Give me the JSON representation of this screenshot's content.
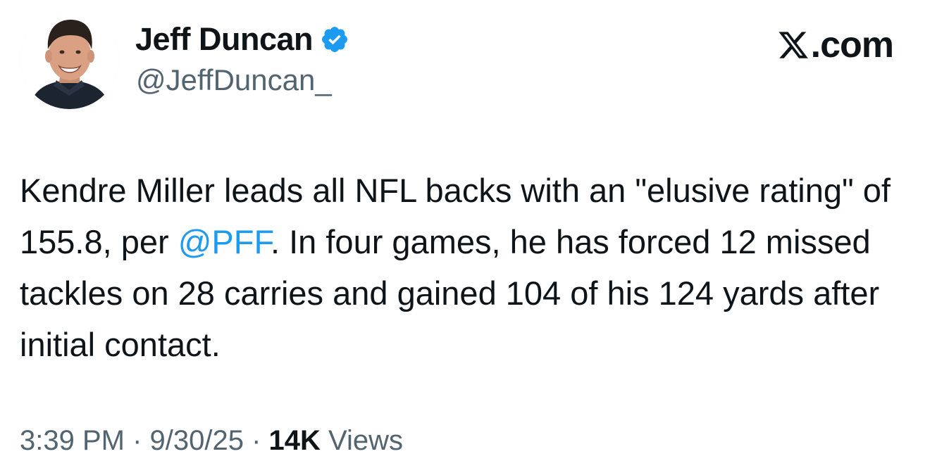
{
  "author": {
    "display_name": "Jeff Duncan",
    "handle": "@JeffDuncan_",
    "verified": true,
    "verified_icon": "verified-badge-icon"
  },
  "brand": {
    "label": ".com",
    "icon": "x-logo-icon"
  },
  "tweet": {
    "text_before_mention": "Kendre Miller leads all NFL backs with an \"elusive rating\" of 155.8, per ",
    "mention": "@PFF",
    "text_after_mention": ". In four games, he has forced 12 missed tackles on 28 carries and gained 104 of his 124 yards after initial contact."
  },
  "meta": {
    "time": "3:39 PM",
    "separator_1": " · ",
    "date": "9/30/25",
    "separator_2": " · ",
    "views_count": "14K",
    "views_label": " Views"
  },
  "colors": {
    "text": "#0f1419",
    "secondary": "#536471",
    "link": "#1d9bf0",
    "verified": "#1d9bf0"
  }
}
